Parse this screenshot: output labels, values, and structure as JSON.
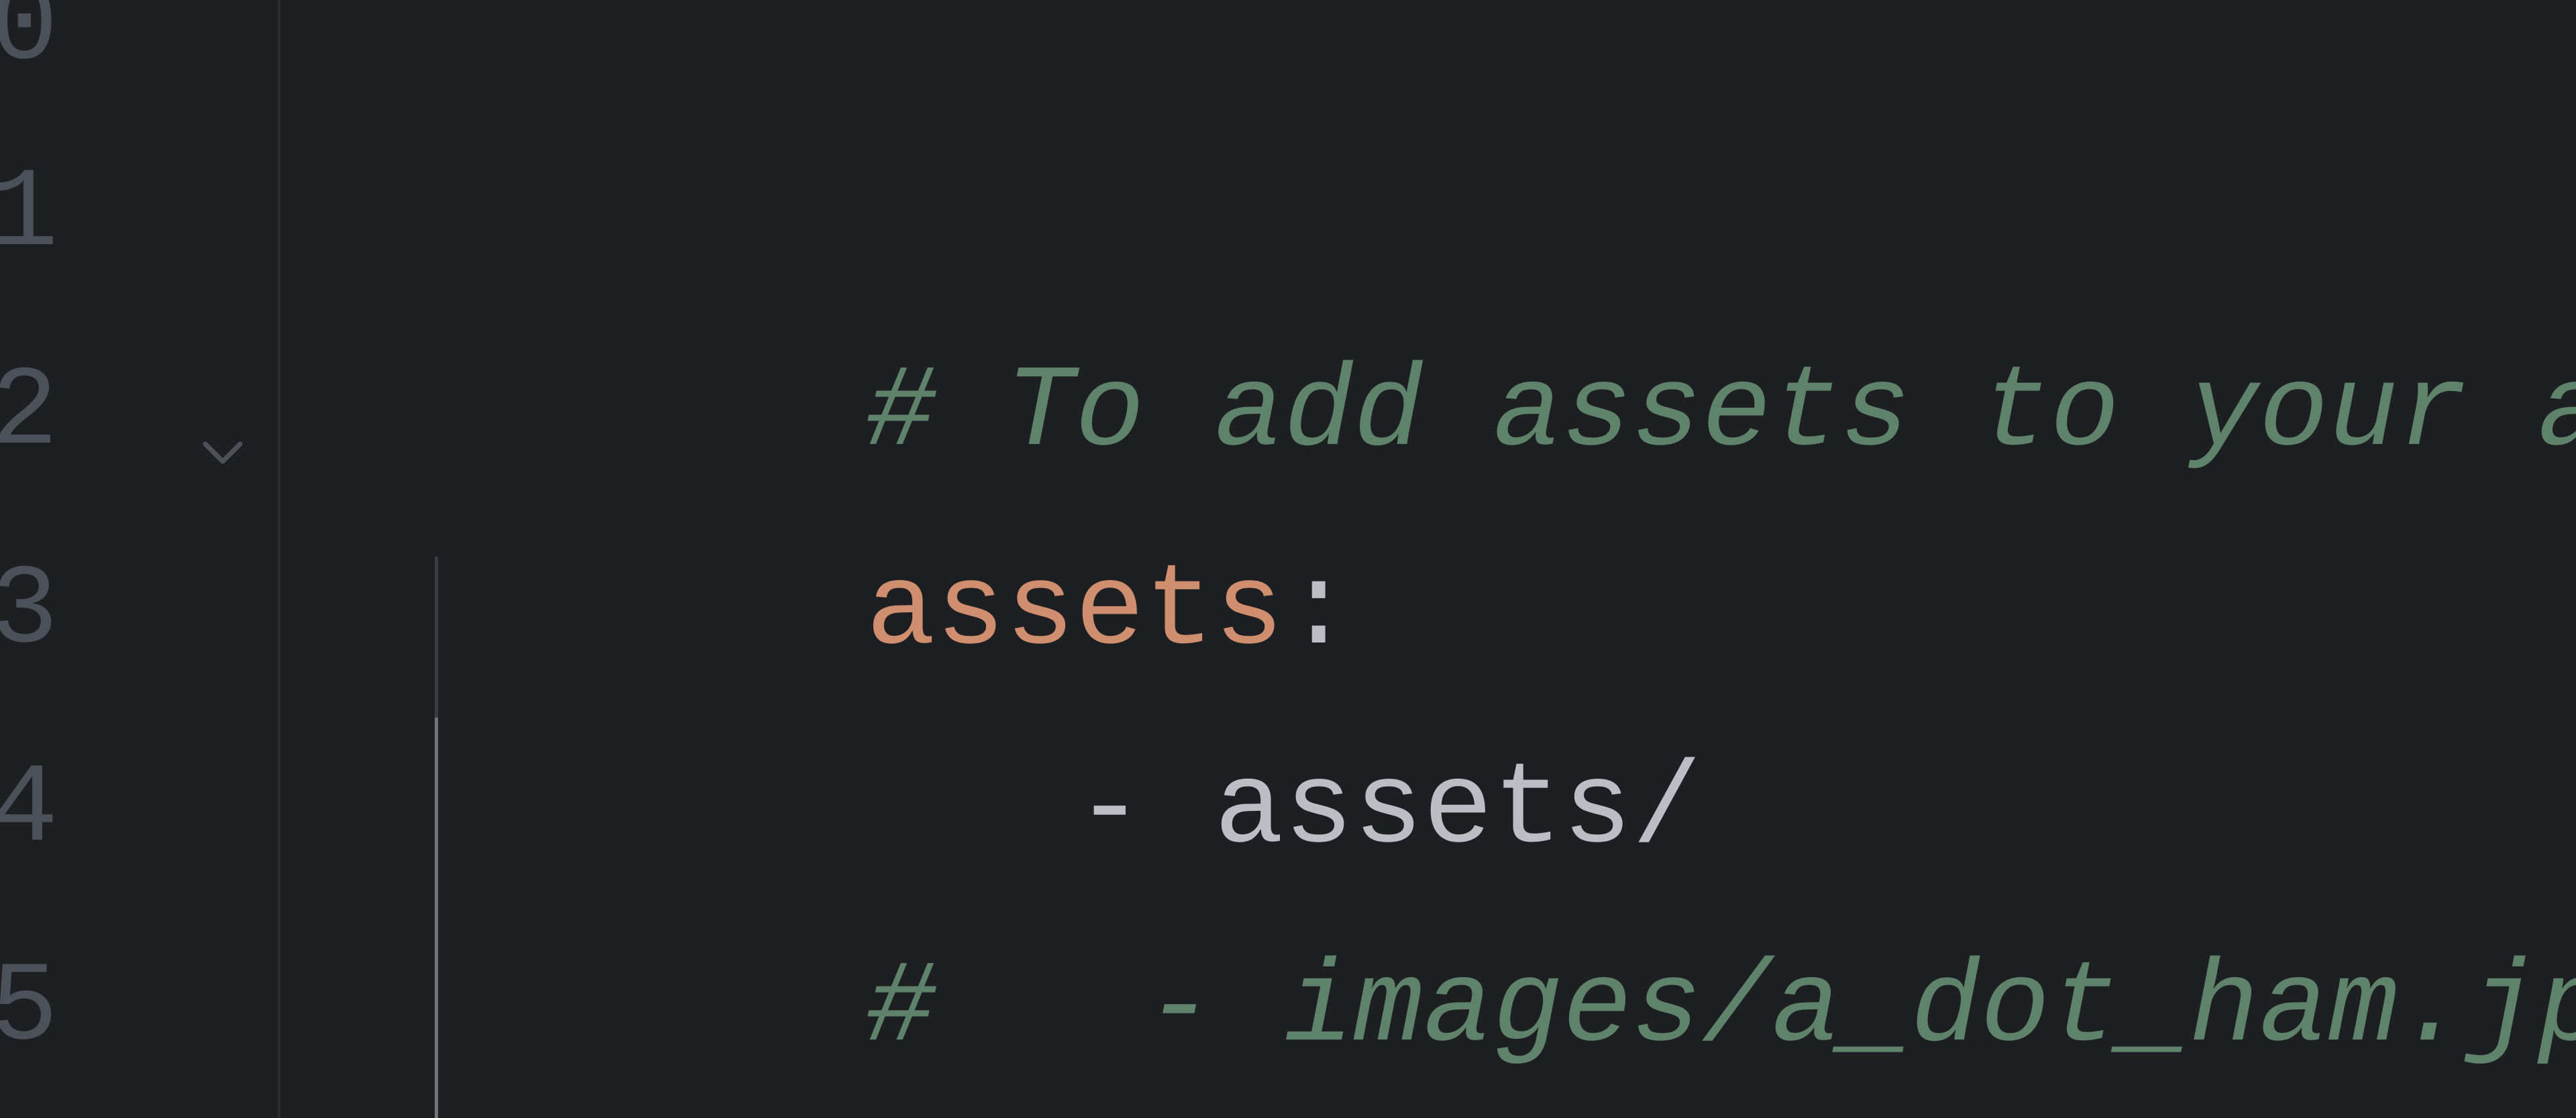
{
  "editor": {
    "language": "yaml",
    "colors": {
      "background": "#1E1F22",
      "gutter_divider": "#2B2D30",
      "line_number": "#4B5059",
      "comment": "#5F826B",
      "key": "#CF8E6D",
      "plain": "#BCBEC4"
    },
    "line_numbers": [
      "0",
      "1",
      "2",
      "3",
      "4",
      "5"
    ],
    "fold_icon": "chevron-down-icon",
    "lines": [
      {
        "tokens": []
      },
      {
        "tokens": [
          {
            "type": "comment",
            "text": "# To add assets to your application"
          }
        ]
      },
      {
        "tokens": [
          {
            "type": "key",
            "text": "assets"
          },
          {
            "type": "punct",
            "text": ":"
          }
        ]
      },
      {
        "tokens": [
          {
            "type": "plain",
            "text": "   - assets/"
          }
        ]
      },
      {
        "tokens": [
          {
            "type": "comment",
            "text": "#   - images/a_dot_ham.jpeg"
          }
        ]
      },
      {
        "tokens": []
      }
    ]
  }
}
